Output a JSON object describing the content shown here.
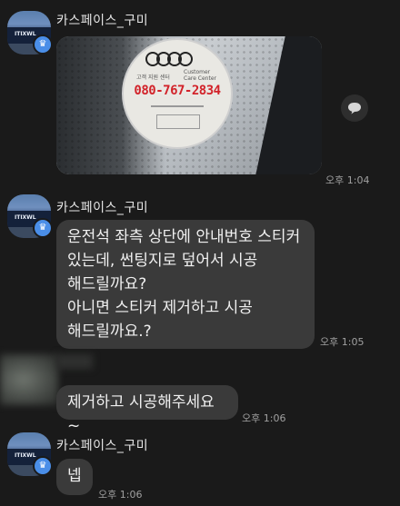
{
  "colors": {
    "background": "#1a1a1a",
    "bubble": "#3a3a3a",
    "text": "#f0f0f0",
    "timestamp": "#a0a0a0",
    "badge": "#4a8ee8",
    "sticker_phone": "#d2232a"
  },
  "sender_name": "카스페이스_구미",
  "avatar_sign": "ITIXWL",
  "messages": [
    {
      "type": "photo",
      "sticker": {
        "brand_line": "고객 지원 센터",
        "phone": "080-767-2834",
        "line1": "Customer",
        "line2": "Care Center"
      },
      "time": "오후 1:04"
    },
    {
      "type": "text",
      "lines": [
        "운전석 좌측 상단에 안내번호 스티커",
        "있는데, 썬팅지로 덮어서 시공",
        "해드릴까요?",
        "아니면 스티커 제거하고 시공",
        "해드릴까요.?"
      ],
      "time": "오후 1:05"
    },
    {
      "type": "text",
      "lines": [
        "제거하고 시공해주세요~"
      ],
      "time": "오후 1:06"
    },
    {
      "type": "text",
      "lines": [
        "넵"
      ],
      "time": "오후 1:06"
    }
  ],
  "icons": {
    "verified": "crown-badge-icon",
    "share": "speech-bubble-icon"
  }
}
